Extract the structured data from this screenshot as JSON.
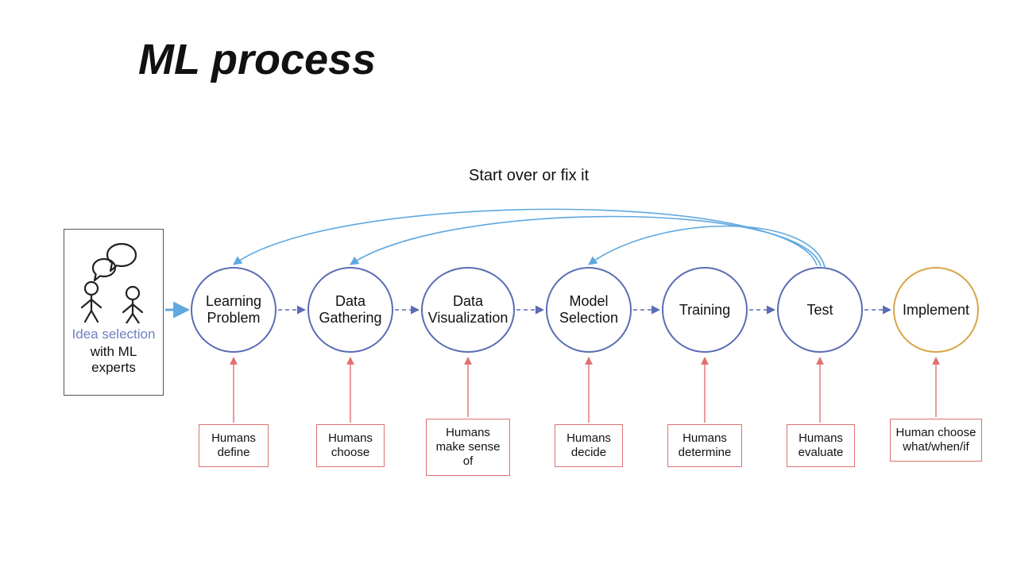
{
  "title": "ML process",
  "idea_box": {
    "line1": "Idea selection",
    "line2": "with ML experts"
  },
  "feedback_label": "Start over or fix it",
  "steps": [
    {
      "label": "Learning Problem",
      "human": "Humans define"
    },
    {
      "label": "Data Gathering",
      "human": "Humans choose"
    },
    {
      "label": "Data Visualization",
      "human": "Humans make sense of"
    },
    {
      "label": "Model Selection",
      "human": "Humans decide"
    },
    {
      "label": "Training",
      "human": "Humans determine"
    },
    {
      "label": "Test",
      "human": "Humans evaluate"
    },
    {
      "label": "Implement",
      "human": "Human choose what/when/if"
    }
  ],
  "colors": {
    "step_border": "#5a6cb3",
    "final_border": "#d7a445",
    "human_border": "#e07070",
    "fwd_arrow": "#5a6cb3",
    "fwd_arrow_first": "#5fa8e0",
    "feedback_arrow": "#5fa8e0",
    "human_arrow": "#e07070",
    "idea_text": "#6e7fbf"
  }
}
